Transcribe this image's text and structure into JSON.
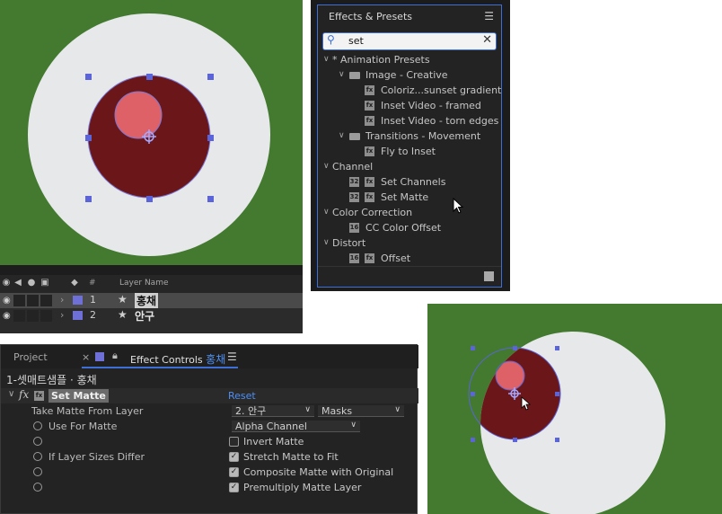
{
  "timeline": {
    "col_hash": "#",
    "col_layer_name": "Layer Name",
    "layers": [
      {
        "num": "1",
        "name": "홍채"
      },
      {
        "num": "2",
        "name": "안구"
      }
    ]
  },
  "effects_presets": {
    "title": "Effects & Presets",
    "search_value": "set",
    "items": [
      {
        "label": "* Animation Presets",
        "kind": "category"
      },
      {
        "label": "Image - Creative",
        "kind": "folder"
      },
      {
        "label": "Coloriz...sunset gradient",
        "kind": "preset"
      },
      {
        "label": "Inset Video - framed",
        "kind": "preset"
      },
      {
        "label": "Inset Video - torn edges",
        "kind": "preset"
      },
      {
        "label": "Transitions - Movement",
        "kind": "folder"
      },
      {
        "label": "Fly to Inset",
        "kind": "preset"
      },
      {
        "label": "Channel",
        "kind": "category"
      },
      {
        "label": "Set Channels",
        "kind": "effect"
      },
      {
        "label": "Set Matte",
        "kind": "effect"
      },
      {
        "label": "Color Correction",
        "kind": "category"
      },
      {
        "label": "CC Color Offset",
        "kind": "effect"
      },
      {
        "label": "Distort",
        "kind": "category"
      },
      {
        "label": "Offset",
        "kind": "effect"
      }
    ]
  },
  "effect_controls": {
    "tab_project": "Project",
    "tab_effect_controls": "Effect Controls",
    "tab_layer": "홍채",
    "breadcrumb": "1-셋매트샘플 · 홍채",
    "effect_name": "Set Matte",
    "reset_label": "Reset",
    "take_matte_label": "Take Matte From Layer",
    "take_matte_value": "2. 안구",
    "take_matte_masks": "Masks",
    "use_for_matte_label": "Use For Matte",
    "use_for_matte_value": "Alpha Channel",
    "invert_matte": "Invert Matte",
    "if_layer_sizes_label": "If Layer Sizes Differ",
    "stretch_matte": "Stretch Matte to Fit",
    "composite_matte": "Composite Matte with Original",
    "premultiply_matte": "Premultiply Matte Layer"
  },
  "colors": {
    "comp_background": "#437a2f",
    "eyeball": "#e6e8ea",
    "iris": "#6b1618",
    "pupil_highlight": "#dd6166",
    "selection_blue": "#6a6aff",
    "accent": "#3d6fd6"
  }
}
